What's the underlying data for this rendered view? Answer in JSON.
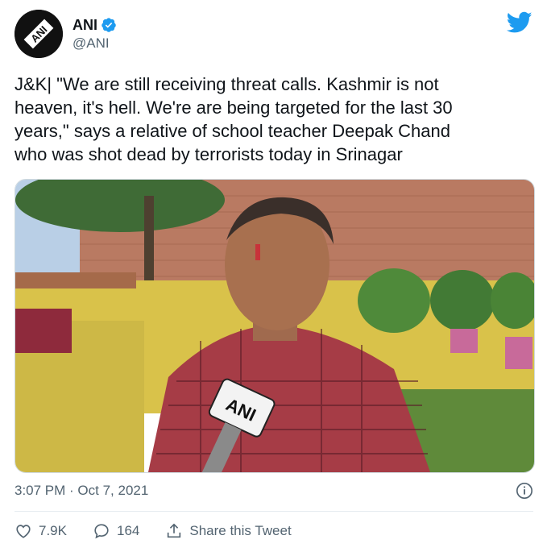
{
  "author": {
    "display_name": "ANI",
    "handle": "@ANI",
    "avatar_text": "ANI"
  },
  "tweet": {
    "text": "J&K| \"We are still receiving threat calls. Kashmir is not\nheaven, it's hell. We're are being targeted for the last 30\nyears,\" says a relative of school teacher Deepak Chand\nwho was shot dead by terrorists today in Srinagar",
    "timestamp": "3:07 PM · Oct 7, 2021"
  },
  "media": {
    "mic_label": "ANI"
  },
  "actions": {
    "likes": "7.9K",
    "replies": "164",
    "share": "Share this Tweet"
  },
  "colors": {
    "twitter_blue": "#1d9bf0",
    "verified": "#1d9bf0",
    "muted": "#536471"
  },
  "icons": [
    "verified-badge-icon",
    "twitter-bird-icon",
    "info-icon",
    "heart-icon",
    "reply-icon",
    "share-icon"
  ]
}
